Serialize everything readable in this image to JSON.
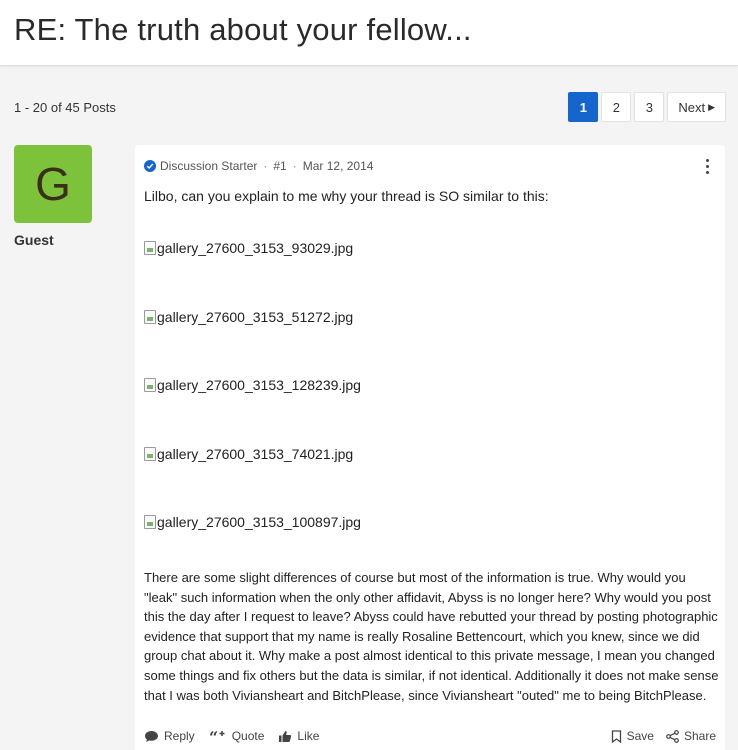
{
  "header": {
    "title": "RE: The truth about your fellow..."
  },
  "posts_count": "1 - 20 of 45 Posts",
  "pagination": {
    "pages": [
      "1",
      "2",
      "3"
    ],
    "active": "1",
    "next_label": "Next"
  },
  "author": {
    "avatar_letter": "G",
    "name": "Guest",
    "avatar_color": "#7cc23a"
  },
  "post": {
    "badge": "Discussion Starter",
    "number": "#1",
    "date": "Mar 12, 2014",
    "intro": "Lilbo, can you explain to me why your thread is SO similar to this:",
    "images": [
      "gallery_27600_3153_93029.jpg",
      "gallery_27600_3153_51272.jpg",
      "gallery_27600_3153_128239.jpg",
      "gallery_27600_3153_74021.jpg",
      "gallery_27600_3153_100897.jpg"
    ],
    "body": "There are some slight differences of course but most of the information is true. Why would you \"leak\" such information when the only other affidavit, Abyss is no longer here? Why would you post this the day after I request to leave? Abyss could have rebutted your thread by posting photographic evidence that support that my name is really Rosaline Bettencourt, which you knew, since we did group chat about it. Why make a post almost identical to this private message, I mean you changed some things and fix others but the data is similar, if not identical. Additionally it does not make sense that I was both Viviansheart and BitchPlease, since Viviansheart \"outed\" me to being BitchPlease."
  },
  "actions": {
    "reply": "Reply",
    "quote": "Quote",
    "like": "Like",
    "save": "Save",
    "share": "Share"
  },
  "colors": {
    "accent": "#1665cc"
  }
}
